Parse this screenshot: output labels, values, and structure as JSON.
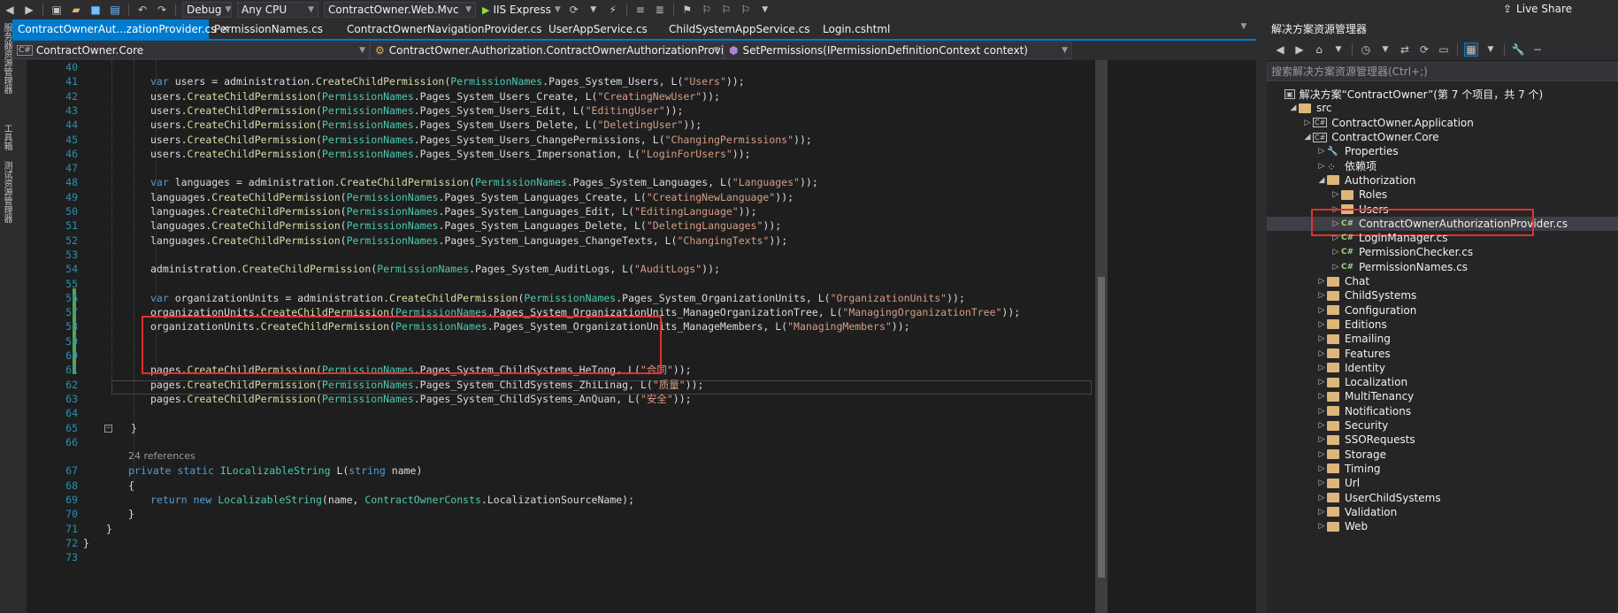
{
  "toolbar": {
    "config": "Debug",
    "platform": "Any CPU",
    "startup_project": "ContractOwner.Web.Mvc",
    "run_label": "IIS Express",
    "live_share": "Live Share"
  },
  "left_rail": [
    "服务器资源管理器",
    "工具箱",
    "测试资源管理器"
  ],
  "tabs": [
    {
      "label": "ContractOwnerAut...zationProvider.cs",
      "active": true
    },
    {
      "label": "PermissionNames.cs"
    },
    {
      "label": "ContractOwnerNavigationProvider.cs"
    },
    {
      "label": "UserAppService.cs"
    },
    {
      "label": "ChildSystemAppService.cs"
    },
    {
      "label": "Login.cshtml"
    }
  ],
  "nav": {
    "project": "ContractOwner.Core",
    "class": "ContractOwner.Authorization.ContractOwnerAuthorizationProvider",
    "member": "SetPermissions(IPermissionDefinitionContext context)"
  },
  "code_lines": [
    {
      "n": "40",
      "t": ""
    },
    {
      "n": "41",
      "t": "var users = administration.CreateChildPermission(PermissionNames.Pages_System_Users, L(\"Users\"));"
    },
    {
      "n": "42",
      "t": "users.CreateChildPermission(PermissionNames.Pages_System_Users_Create, L(\"CreatingNewUser\"));"
    },
    {
      "n": "43",
      "t": "users.CreateChildPermission(PermissionNames.Pages_System_Users_Edit, L(\"EditingUser\"));"
    },
    {
      "n": "44",
      "t": "users.CreateChildPermission(PermissionNames.Pages_System_Users_Delete, L(\"DeletingUser\"));"
    },
    {
      "n": "45",
      "t": "users.CreateChildPermission(PermissionNames.Pages_System_Users_ChangePermissions, L(\"ChangingPermissions\"));"
    },
    {
      "n": "46",
      "t": "users.CreateChildPermission(PermissionNames.Pages_System_Users_Impersonation, L(\"LoginForUsers\"));"
    },
    {
      "n": "47",
      "t": ""
    },
    {
      "n": "48",
      "t": "var languages = administration.CreateChildPermission(PermissionNames.Pages_System_Languages, L(\"Languages\"));"
    },
    {
      "n": "49",
      "t": "languages.CreateChildPermission(PermissionNames.Pages_System_Languages_Create, L(\"CreatingNewLanguage\"));"
    },
    {
      "n": "50",
      "t": "languages.CreateChildPermission(PermissionNames.Pages_System_Languages_Edit, L(\"EditingLanguage\"));"
    },
    {
      "n": "51",
      "t": "languages.CreateChildPermission(PermissionNames.Pages_System_Languages_Delete, L(\"DeletingLanguages\"));"
    },
    {
      "n": "52",
      "t": "languages.CreateChildPermission(PermissionNames.Pages_System_Languages_ChangeTexts, L(\"ChangingTexts\"));"
    },
    {
      "n": "53",
      "t": ""
    },
    {
      "n": "54",
      "t": "administration.CreateChildPermission(PermissionNames.Pages_System_AuditLogs, L(\"AuditLogs\"));"
    },
    {
      "n": "55",
      "t": ""
    },
    {
      "n": "56",
      "t": "var organizationUnits = administration.CreateChildPermission(PermissionNames.Pages_System_OrganizationUnits, L(\"OrganizationUnits\"));"
    },
    {
      "n": "57",
      "t": "organizationUnits.CreateChildPermission(PermissionNames.Pages_System_OrganizationUnits_ManageOrganizationTree, L(\"ManagingOrganizationTree\"));"
    },
    {
      "n": "58",
      "t": "organizationUnits.CreateChildPermission(PermissionNames.Pages_System_OrganizationUnits_ManageMembers, L(\"ManagingMembers\"));"
    },
    {
      "n": "59",
      "t": ""
    },
    {
      "n": "60",
      "t": ""
    },
    {
      "n": "61",
      "t": "pages.CreateChildPermission(PermissionNames.Pages_System_ChildSystems_HeTong, L(\"合同\"));"
    },
    {
      "n": "62",
      "t": "pages.CreateChildPermission(PermissionNames.Pages_System_ChildSystems_ZhiLinag, L(\"质量\"));"
    },
    {
      "n": "63",
      "t": "pages.CreateChildPermission(PermissionNames.Pages_System_ChildSystems_AnQuan, L(\"安全\"));"
    },
    {
      "n": "64",
      "t": ""
    },
    {
      "n": "65",
      "t": "}"
    },
    {
      "n": "66",
      "t": ""
    },
    {
      "n": "",
      "t": "24 references"
    },
    {
      "n": "67",
      "t": "private static ILocalizableString L(string name)"
    },
    {
      "n": "68",
      "t": "{"
    },
    {
      "n": "69",
      "t": "return new LocalizableString(name, ContractOwnerConsts.LocalizationSourceName);"
    },
    {
      "n": "70",
      "t": "}"
    },
    {
      "n": "71",
      "t": "}"
    },
    {
      "n": "72",
      "t": "}"
    },
    {
      "n": "73",
      "t": ""
    }
  ],
  "solution_explorer": {
    "title": "解决方案资源管理器",
    "search_placeholder": "搜索解决方案资源管理器(Ctrl+;)",
    "tree": [
      {
        "label": "解决方案“ContractOwner”(第 7 个项目，共 7 个)",
        "kind": "solution"
      },
      {
        "label": "src",
        "kind": "folder"
      },
      {
        "label": "ContractOwner.Application",
        "kind": "project"
      },
      {
        "label": "ContractOwner.Core",
        "kind": "project"
      },
      {
        "label": "Properties",
        "kind": "props"
      },
      {
        "label": "依赖项",
        "kind": "deps"
      },
      {
        "label": "Authorization",
        "kind": "folder"
      },
      {
        "label": "Roles",
        "kind": "folder"
      },
      {
        "label": "Users",
        "kind": "folder"
      },
      {
        "label": "ContractOwnerAuthorizationProvider.cs",
        "kind": "cs",
        "selected": true
      },
      {
        "label": "LoginManager.cs",
        "kind": "cs"
      },
      {
        "label": "PermissionChecker.cs",
        "kind": "cs"
      },
      {
        "label": "PermissionNames.cs",
        "kind": "cs"
      },
      {
        "label": "Chat",
        "kind": "folder"
      },
      {
        "label": "ChildSystems",
        "kind": "folder"
      },
      {
        "label": "Configuration",
        "kind": "folder"
      },
      {
        "label": "Editions",
        "kind": "folder"
      },
      {
        "label": "Emailing",
        "kind": "folder"
      },
      {
        "label": "Features",
        "kind": "folder"
      },
      {
        "label": "Identity",
        "kind": "folder"
      },
      {
        "label": "Localization",
        "kind": "folder"
      },
      {
        "label": "MultiTenancy",
        "kind": "folder"
      },
      {
        "label": "Notifications",
        "kind": "folder"
      },
      {
        "label": "Security",
        "kind": "folder"
      },
      {
        "label": "SSORequests",
        "kind": "folder"
      },
      {
        "label": "Storage",
        "kind": "folder"
      },
      {
        "label": "Timing",
        "kind": "folder"
      },
      {
        "label": "Url",
        "kind": "folder"
      },
      {
        "label": "UserChildSystems",
        "kind": "folder"
      },
      {
        "label": "Validation",
        "kind": "folder"
      },
      {
        "label": "Web",
        "kind": "folder"
      }
    ]
  },
  "colors": {
    "accent": "#007acc",
    "highlight_box": "#e03030",
    "change_bar": "#57a64a"
  }
}
